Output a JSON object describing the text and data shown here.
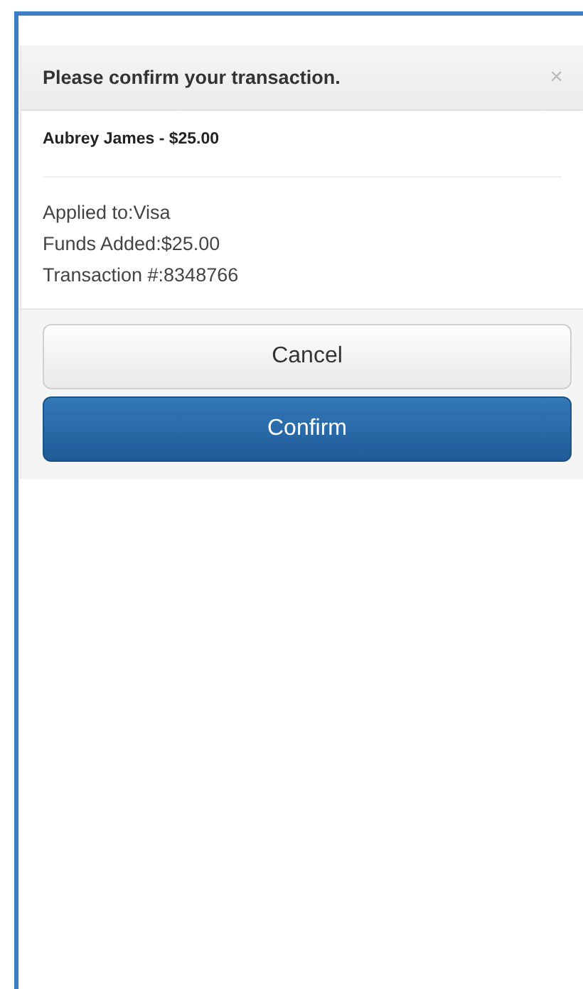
{
  "dialog": {
    "title": "Please confirm your transaction.",
    "close": "×",
    "subtitle": "Aubrey James - $25.00",
    "details": [
      "Applied to:Visa",
      "Funds Added:$25.00",
      "Transaction #:8348766"
    ],
    "buttons": [
      {
        "label": "Cancel",
        "kind": "default"
      },
      {
        "label": "Confirm",
        "kind": "primary"
      }
    ]
  }
}
